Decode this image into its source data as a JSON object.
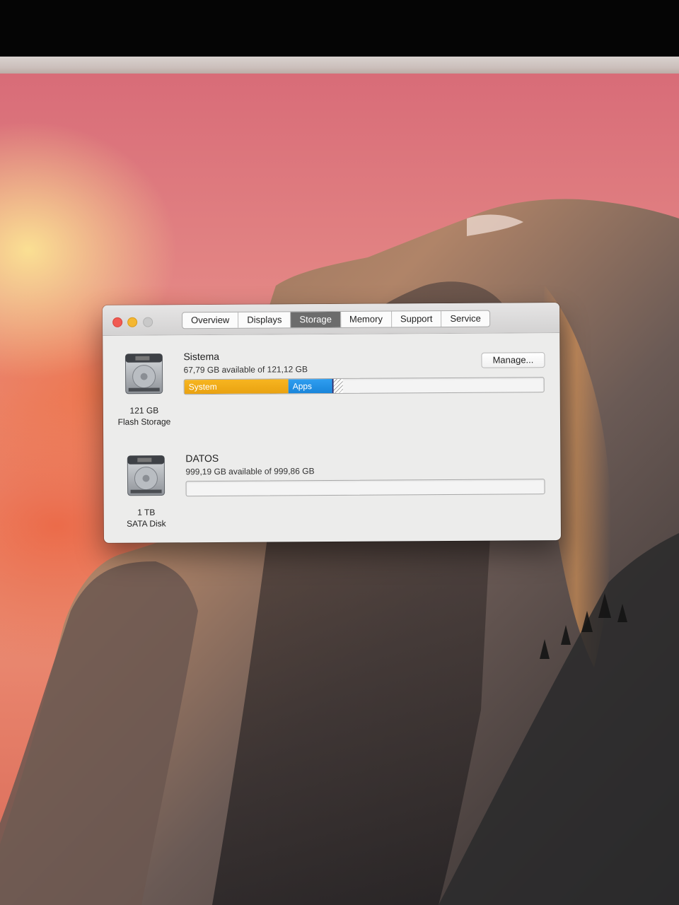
{
  "window": {
    "tabs": [
      {
        "label": "Overview",
        "active": false
      },
      {
        "label": "Displays",
        "active": false
      },
      {
        "label": "Storage",
        "active": true
      },
      {
        "label": "Memory",
        "active": false
      },
      {
        "label": "Support",
        "active": false
      },
      {
        "label": "Service",
        "active": false
      }
    ],
    "manage_label": "Manage..."
  },
  "volumes": [
    {
      "name": "Sistema",
      "available_text": "67,79 GB available of 121,12 GB",
      "disk_size": "121 GB",
      "disk_type": "Flash Storage",
      "icon": "hard-drive-icon",
      "usage_segments": [
        {
          "label": "System",
          "fraction": 0.29,
          "color": "#f2ad19"
        },
        {
          "label": "Apps",
          "fraction": 0.125,
          "color": "#2593e6"
        },
        {
          "label": "",
          "fraction": 0.025,
          "color": "striped"
        }
      ]
    },
    {
      "name": "DATOS",
      "available_text": "999,19 GB available of 999,86 GB",
      "disk_size": "1 TB",
      "disk_type": "SATA Disk",
      "icon": "hard-drive-icon",
      "usage_segments": []
    }
  ],
  "colors": {
    "close": "#f05a52",
    "minimize": "#f4b731",
    "zoom": "#c9c9c9",
    "active_tab": "#6c6c6c"
  }
}
